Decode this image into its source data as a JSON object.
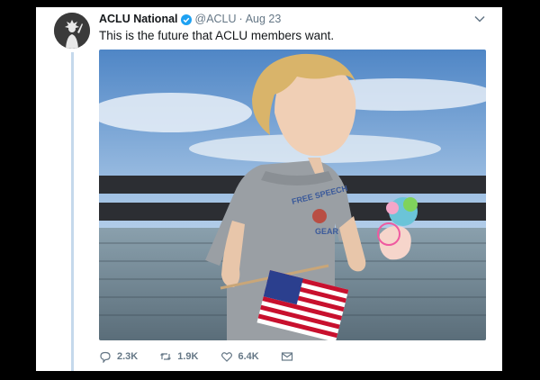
{
  "tweet": {
    "name": "ACLU National",
    "handle": "@ACLU",
    "separator": "·",
    "date": "Aug 23",
    "text": "This is the future that ACLU members want.",
    "verified_color": "#1da1f2",
    "shirt_text_top": "FREE SPEECH",
    "shirt_text_bottom": "GEAR"
  },
  "actions": {
    "reply_count": "2.3K",
    "retweet_count": "1.9K",
    "like_count": "6.4K"
  }
}
